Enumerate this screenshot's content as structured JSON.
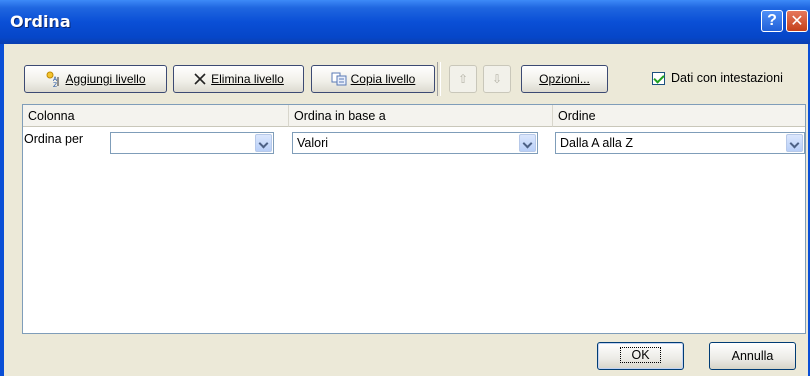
{
  "window": {
    "title": "Ordina",
    "help_label": "?"
  },
  "toolbar": {
    "add_level": "Aggiungi livello",
    "delete_level": "Elimina livello",
    "copy_level": "Copia livello",
    "options": "Opzioni...",
    "move_up_glyph": "⇧",
    "move_down_glyph": "⇩"
  },
  "headers_checkbox": {
    "label": "Dati con intestazioni",
    "checked": true
  },
  "grid": {
    "columns": [
      "Colonna",
      "Ordina in base a",
      "Ordine"
    ],
    "row": {
      "label": "Ordina per",
      "column_value": "",
      "sort_on_value": "Valori",
      "order_value": "Dalla A alla Z"
    }
  },
  "footer": {
    "ok": "OK",
    "cancel": "Annulla"
  },
  "colors": {
    "titlebar": "#0a4fd6",
    "dialog_bg": "#ece9d8",
    "close": "#c4401b"
  }
}
